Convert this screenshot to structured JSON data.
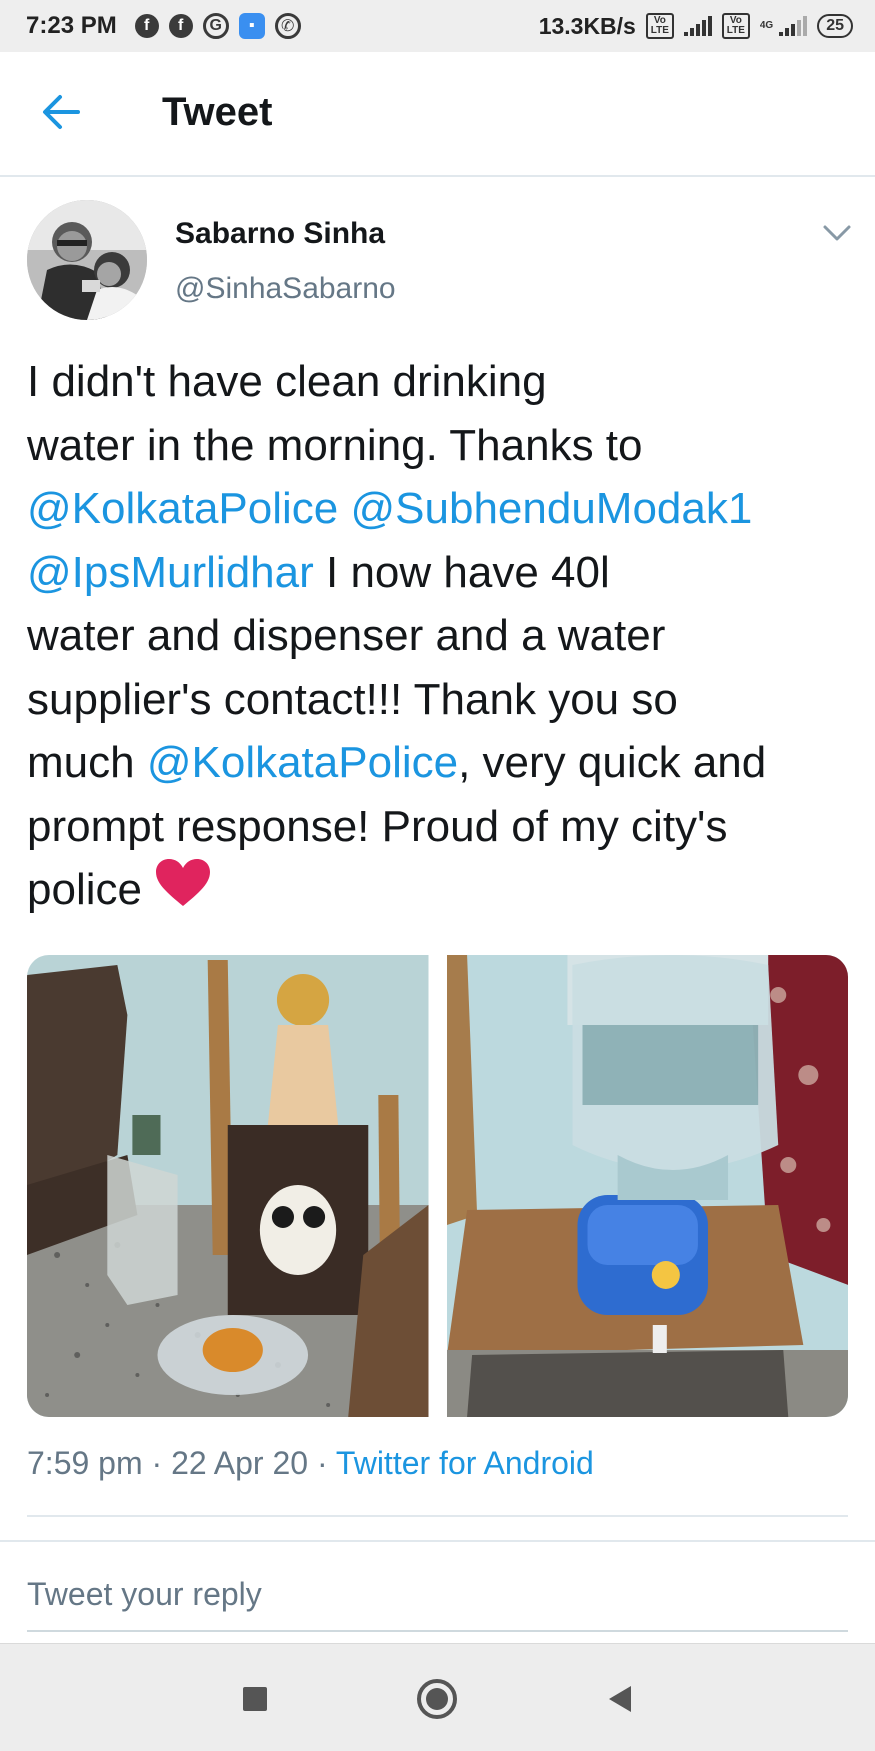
{
  "status_bar": {
    "time": "7:23 PM",
    "app_icons": [
      "facebook-icon",
      "facebook-icon",
      "app-icon",
      "messenger-icon",
      "whatsapp-icon"
    ],
    "net_speed": "13.3KB/s",
    "sim1_badge": "Vo LTE",
    "sim2_badge": "Vo LTE",
    "sim2_network": "4G",
    "battery": "25"
  },
  "header": {
    "title": "Tweet",
    "back_icon": "arrow-left-icon"
  },
  "tweet": {
    "author_name": "Sabarno Sinha",
    "author_handle": "@SinhaSabarno",
    "text": {
      "part1": "I didn't have clean drinking\nwater in the morning. Thanks to\n",
      "mention1": "@KolkataPolice",
      "sp1": " ",
      "mention2": "@SubhenduModak1",
      "br1": "\n",
      "mention3": "@IpsMurlidhar",
      "part2": " I now have 40l\nwater and dispenser and a water\nsupplier's contact!!! Thank you so\nmuch ",
      "mention4": "@KolkataPolice",
      "part3": ", very quick and\nprompt response! Proud of my city's\npolice "
    },
    "emoji": "heart-icon",
    "photos": [
      "photo-shrine-water-bottle",
      "photo-water-dispenser"
    ],
    "time": "7:59 pm",
    "sep1": " · ",
    "date": "22 Apr 20",
    "sep2": " · ",
    "source": "Twitter for Android"
  },
  "reply": {
    "placeholder": "Tweet your reply"
  },
  "colors": {
    "accent": "#1b95e0",
    "secondary_text": "#657786",
    "primary_text": "#14171a",
    "heart": "#e0245e"
  }
}
